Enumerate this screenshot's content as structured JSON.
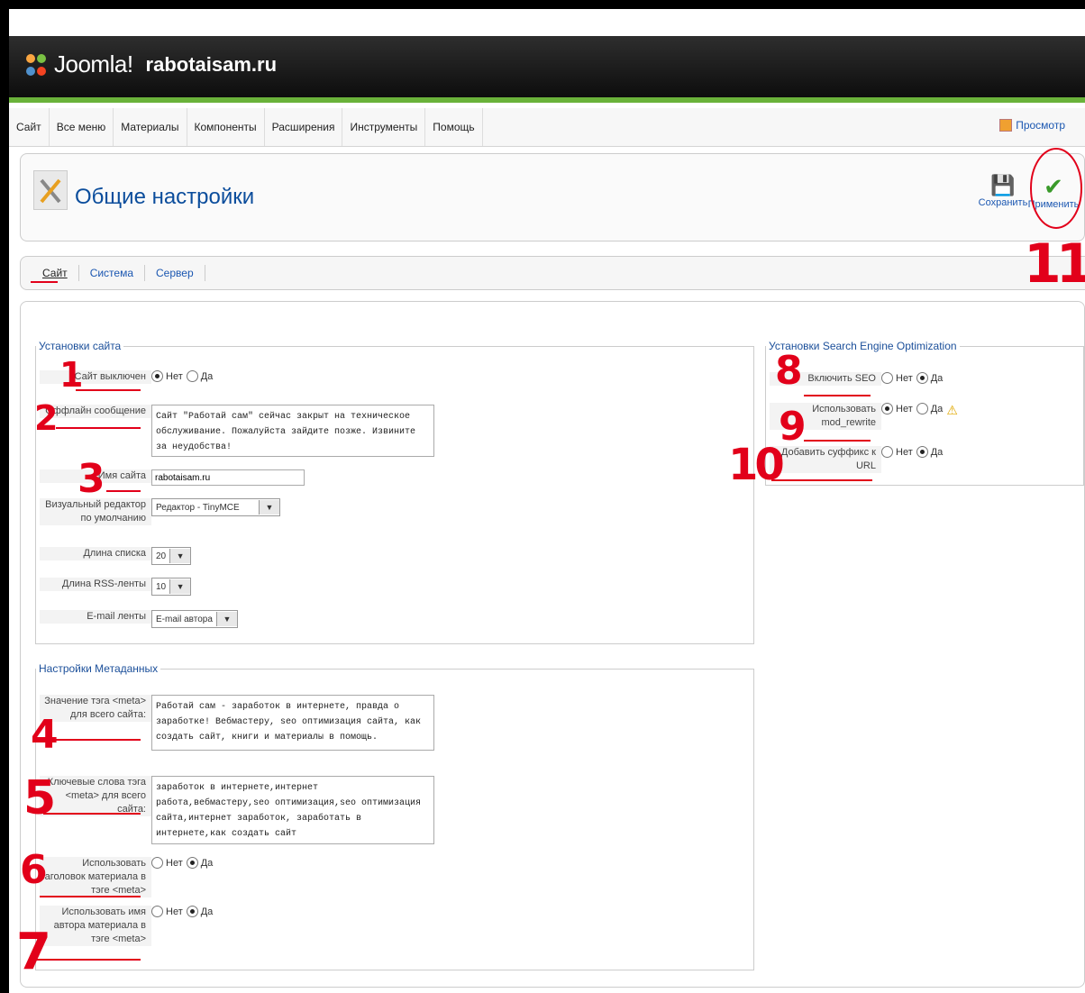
{
  "header": {
    "brand": "Joomla!",
    "site_name": "rabotaisam.ru"
  },
  "menu": {
    "items": [
      "Сайт",
      "Все меню",
      "Материалы",
      "Компоненты",
      "Расширения",
      "Инструменты",
      "Помощь"
    ],
    "preview": "Просмотр"
  },
  "toolbar": {
    "title": "Общие настройки",
    "save_label": "Сохранить",
    "apply_label": "Применить"
  },
  "tabs": [
    "Сайт",
    "Система",
    "Сервер"
  ],
  "site_settings": {
    "legend": "Установки сайта",
    "offline_label": "Сайт выключен",
    "no": "Нет",
    "yes": "Да",
    "offline_msg_label": "Оффлайн сообщение",
    "offline_msg": "Сайт \"Работай сам\" сейчас закрыт на техническое обслуживание. Пожалуйста зайдите позже. Извините за неудобства!",
    "sitename_label": "Имя сайта",
    "sitename_value": "rabotaisam.ru",
    "editor_label": "Визуальный редактор по умолчанию",
    "editor_value": "Редактор - TinyMCE",
    "list_len_label": "Длина списка",
    "list_len_value": "20",
    "rss_len_label": "Длина RSS-ленты",
    "rss_len_value": "10",
    "email_label": "E-mail ленты",
    "email_value": "E-mail автора"
  },
  "meta_settings": {
    "legend": "Настройки Метаданных",
    "desc_label": "Значение тэга <meta> для всего сайта:",
    "desc_value": "Работай сам - заработок в интернете, правда о заработке! Вебмастеру, seo оптимизация сайта, как создать сайт, книги и материалы в помощь.",
    "kw_label": "Ключевые слова тэга <meta> для всего сайта:",
    "kw_value": "заработок в интернете,интернет работа,вебмастеру,seo оптимизация,seo оптимизация сайта,интернет заработок, заработать в интернете,как создать сайт",
    "title_label": "Использовать заголовок материала в тэге <meta>",
    "author_label": "Использовать имя автора материала в тэге <meta>"
  },
  "seo_settings": {
    "legend": "Установки Search Engine Optimization",
    "sef_label": "Включить SEO",
    "rewrite_label": "Использовать mod_rewrite",
    "suffix_label": "Добавить суффикс к URL"
  },
  "annotations": [
    "1",
    "2",
    "3",
    "4",
    "5",
    "6",
    "7",
    "8",
    "9",
    "10",
    "11"
  ],
  "colors": {
    "accent": "#6ab23a",
    "link": "#1b57b1",
    "annotation": "#e2001a"
  }
}
